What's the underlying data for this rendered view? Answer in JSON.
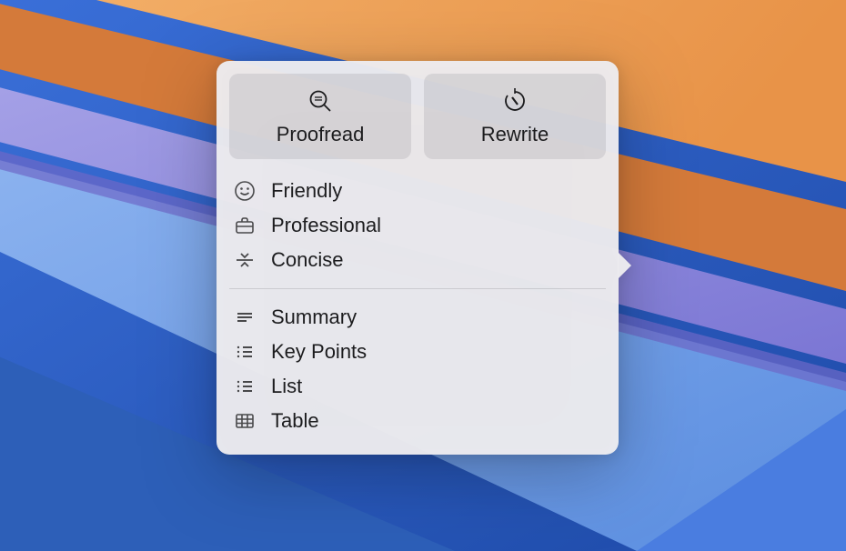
{
  "actions": {
    "proofread": {
      "label": "Proofread"
    },
    "rewrite": {
      "label": "Rewrite"
    }
  },
  "tone_items": [
    {
      "label": "Friendly",
      "icon": "smiley-icon"
    },
    {
      "label": "Professional",
      "icon": "briefcase-icon"
    },
    {
      "label": "Concise",
      "icon": "collapse-icon"
    }
  ],
  "format_items": [
    {
      "label": "Summary",
      "icon": "text-lines-icon"
    },
    {
      "label": "Key Points",
      "icon": "bullet-list-icon"
    },
    {
      "label": "List",
      "icon": "bullet-list-icon"
    },
    {
      "label": "Table",
      "icon": "table-icon"
    }
  ]
}
